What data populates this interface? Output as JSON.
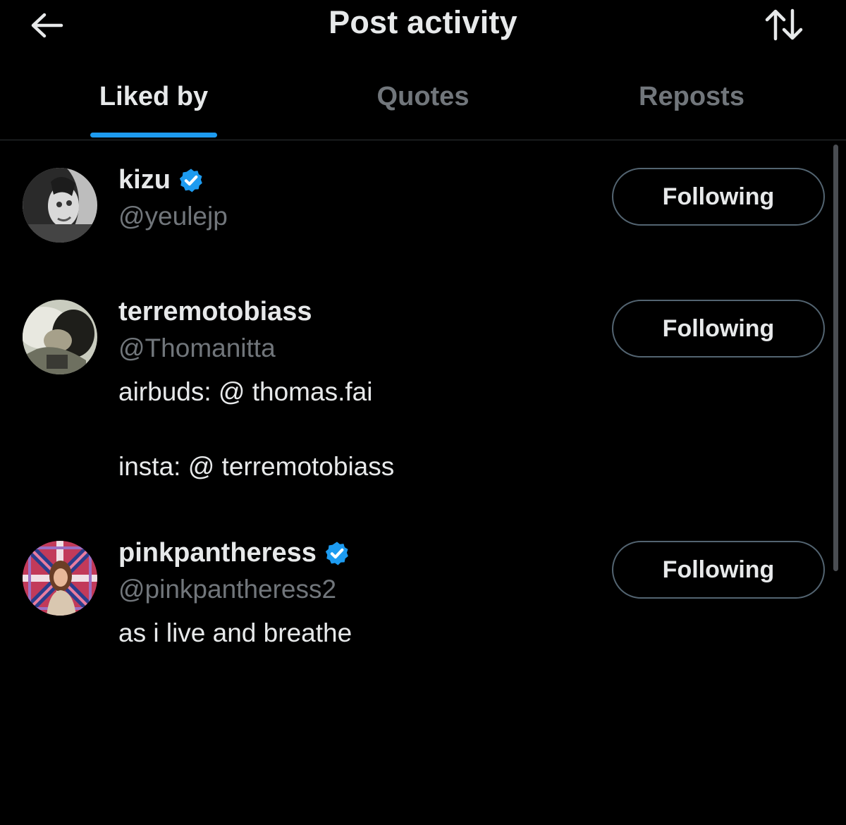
{
  "header": {
    "title": "Post activity",
    "back_icon": "arrow-left-icon",
    "sort_icon": "sort-arrows-icon"
  },
  "tabs": [
    {
      "label": "Liked by",
      "active": true
    },
    {
      "label": "Quotes",
      "active": false
    },
    {
      "label": "Reposts",
      "active": false
    }
  ],
  "users": [
    {
      "name": "kizu",
      "handle": "@yeulejp",
      "verified": true,
      "bio_lines": [],
      "button": "Following"
    },
    {
      "name": "terremotobiass",
      "handle": "@Thomanitta",
      "verified": false,
      "bio_lines": [
        "airbuds: @ thomas.fai",
        "",
        "insta: @ terremotobiass"
      ],
      "button": "Following"
    },
    {
      "name": "pinkpantheress",
      "handle": "@pinkpantheress2",
      "verified": true,
      "bio_lines": [
        "as i live and breathe"
      ],
      "button": "Following"
    }
  ],
  "colors": {
    "background": "#000000",
    "accent": "#1d9bf0",
    "text_primary": "#e7e9ea",
    "text_secondary": "#71767b",
    "button_border": "#536471"
  }
}
